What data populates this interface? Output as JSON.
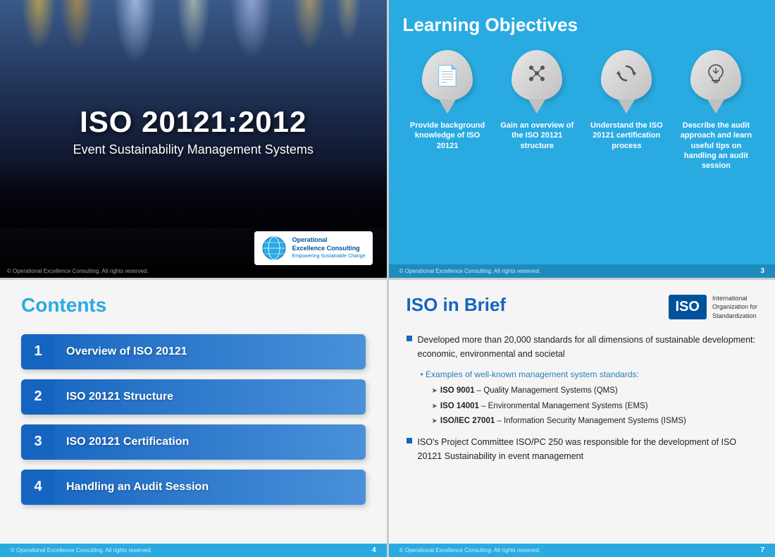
{
  "slide1": {
    "main_title": "ISO 20121:2012",
    "subtitle": "Event Sustainability Management Systems",
    "logo_text_line1": "Operational",
    "logo_text_line2": "Excellence Consulting",
    "logo_text_line3": "Empowering Sustainable Change",
    "copyright": "© Operational Excellence Consulting.  All rights reserved."
  },
  "slide2": {
    "title": "Learning Objectives",
    "icons": [
      {
        "symbol": "📄",
        "label": "Provide background knowledge of ISO 20121"
      },
      {
        "symbol": "✦",
        "label": "Gain an overview of the ISO 20121 structure"
      },
      {
        "symbol": "↻",
        "label": "Understand the ISO 20121 certification process"
      },
      {
        "symbol": "💡",
        "label": "Describe the audit approach and learn useful tips on handling an audit session"
      }
    ],
    "copyright": "© Operational Excellence Consulting.  All rights reserved.",
    "page": "3"
  },
  "slide3": {
    "title": "Contents",
    "items": [
      {
        "num": "1",
        "label": "Overview of ISO 20121"
      },
      {
        "num": "2",
        "label": "ISO 20121 Structure"
      },
      {
        "num": "3",
        "label": "ISO 20121 Certification"
      },
      {
        "num": "4",
        "label": "Handling an Audit Session"
      }
    ],
    "copyright": "© Operational Excellence Consulting.  All rights reserved.",
    "page": "4"
  },
  "slide4": {
    "title": "ISO in Brief",
    "iso_logo": "ISO",
    "iso_org_text": "International\nOrganization for\nStandardization",
    "bullet1": "Developed more than 20,000 standards for all dimensions of sustainable development: economic, environmental and societal",
    "sub_link": "Examples of well-known management system standards:",
    "standards": [
      {
        "bold": "ISO 9001",
        "rest": " – Quality Management Systems (QMS)"
      },
      {
        "bold": "ISO 14001",
        "rest": " – Environmental Management Systems (EMS)"
      },
      {
        "bold": "ISO/IEC 27001",
        "rest": " – Information Security Management Systems (ISMS)"
      }
    ],
    "bullet2": "ISO's Project Committee ISO/PC 250 was responsible for the development of ISO 20121 Sustainability in event management",
    "copyright": "© Operational Excellence Consulting.  All rights reserved.",
    "page": "7"
  }
}
